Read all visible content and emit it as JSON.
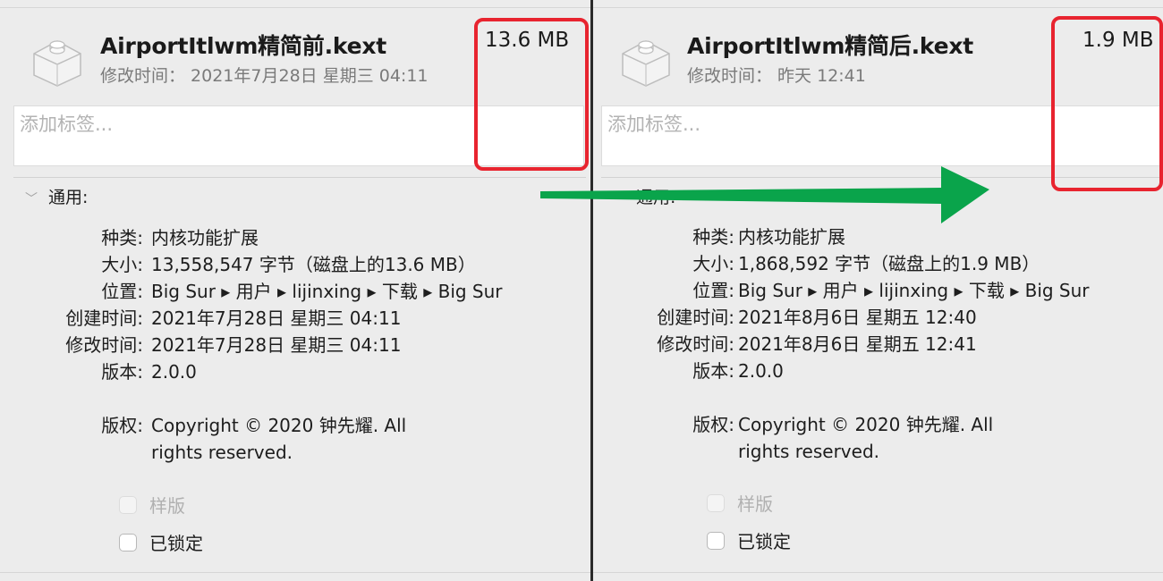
{
  "left": {
    "title": "AirportItlwm精简前.kext",
    "modified_header": "修改时间： 2021年7月28日 星期三 04:11",
    "size": "13.6 MB",
    "tags_placeholder": "添加标签...",
    "section": "通用:",
    "rows": [
      {
        "label": "种类:",
        "value": "内核功能扩展"
      },
      {
        "label": "大小:",
        "value": "13,558,547 字节（磁盘上的13.6 MB）"
      },
      {
        "label": "位置:",
        "value": "Big Sur ▸ 用户 ▸ lijinxing ▸ 下载 ▸ Big Sur"
      },
      {
        "label": "创建时间:",
        "value": "2021年7月28日 星期三 04:11"
      },
      {
        "label": "修改时间:",
        "value": "2021年7月28日 星期三 04:11"
      },
      {
        "label": "版本:",
        "value": "2.0.0"
      }
    ],
    "copyright_label": "版权:",
    "copyright_line1": "Copyright © 2020 钟先耀. All",
    "copyright_line2": "rights reserved.",
    "stationery_label": "样版",
    "locked_label": "已锁定"
  },
  "right": {
    "title": "AirportItlwm精简后.kext",
    "modified_header": "修改时间： 昨天 12:41",
    "size": "1.9 MB",
    "tags_placeholder": "添加标签...",
    "section": "通用:",
    "rows": [
      {
        "label": "种类:",
        "value": "内核功能扩展"
      },
      {
        "label": "大小:",
        "value": "1,868,592 字节（磁盘上的1.9 MB）"
      },
      {
        "label": "位置:",
        "value": "Big Sur ▸ 用户 ▸ lijinxing ▸ 下载 ▸ Big Sur"
      },
      {
        "label": "创建时间:",
        "value": "2021年8月6日 星期五 12:40"
      },
      {
        "label": "修改时间:",
        "value": "2021年8月6日 星期五 12:41"
      },
      {
        "label": "版本:",
        "value": "2.0.0"
      }
    ],
    "copyright_label": "版权:",
    "copyright_line1": "Copyright © 2020 钟先耀. All",
    "copyright_line2": "rights reserved.",
    "stationery_label": "样版",
    "locked_label": "已锁定"
  },
  "annotation_colors": {
    "highlight": "#e8242f",
    "arrow": "#0aa44b"
  }
}
